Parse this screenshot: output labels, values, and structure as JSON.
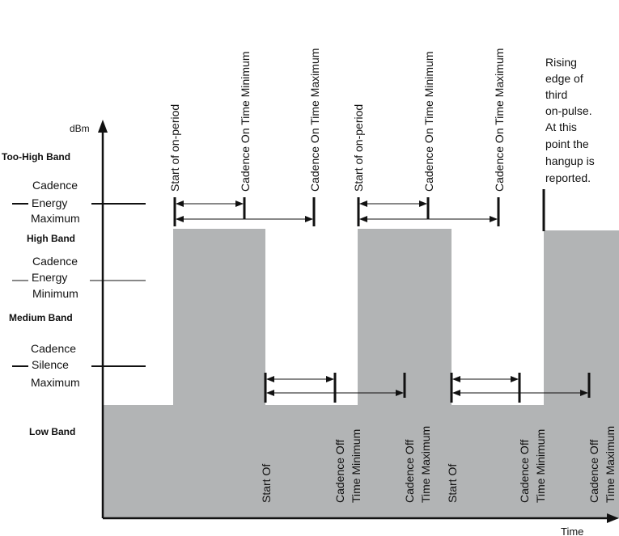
{
  "axes": {
    "y_label": "dBm",
    "x_label": "Time"
  },
  "bands": [
    "Too-High Band",
    "High Band",
    "Medium Band",
    "Low Band"
  ],
  "thresholds": [
    [
      "Cadence",
      "Energy",
      "Maximum"
    ],
    [
      "Cadence",
      "Energy",
      "Minimum"
    ],
    [
      "Cadence",
      "Silence",
      "Maximum"
    ]
  ],
  "on_markers": [
    "Start of on-period",
    "Cadence On Time Minimum",
    "Cadence On Time Maximum"
  ],
  "off_markers": {
    "start": "Start Of",
    "min": [
      "Cadence Off",
      "Time Minimum"
    ],
    "max": [
      "Cadence Off",
      "Time Maximum"
    ]
  },
  "note": [
    "Rising",
    "edge of",
    "third",
    "on-pulse.",
    "At this",
    "point the",
    "hangup is",
    "reported."
  ],
  "colors": {
    "signal_fill": "#b2b4b5",
    "line": "#111111"
  }
}
